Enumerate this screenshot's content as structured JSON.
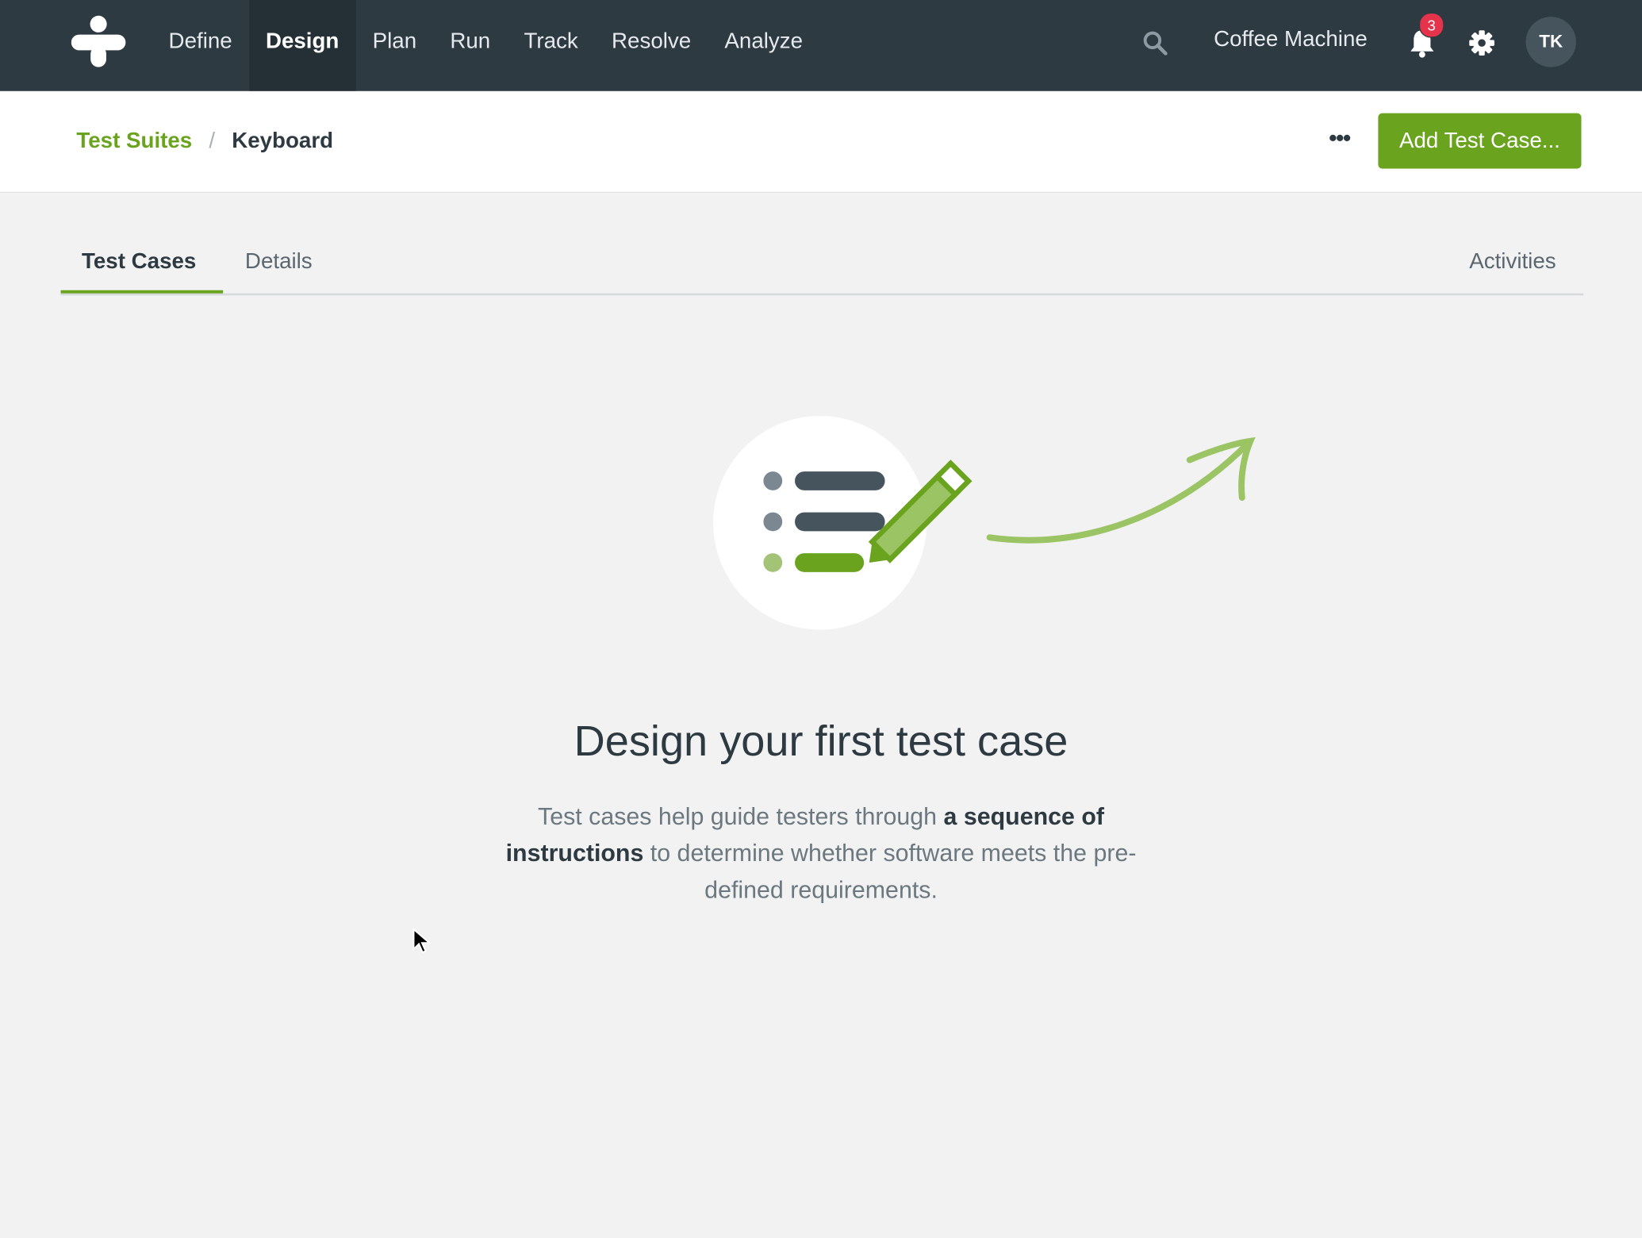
{
  "nav": {
    "items": [
      {
        "label": "Define"
      },
      {
        "label": "Design"
      },
      {
        "label": "Plan"
      },
      {
        "label": "Run"
      },
      {
        "label": "Track"
      },
      {
        "label": "Resolve"
      },
      {
        "label": "Analyze"
      }
    ],
    "active": "Design",
    "project_name": "Coffee Machine",
    "notification_count": "3",
    "avatar_initials": "TK"
  },
  "breadcrumb": {
    "parent": "Test Suites",
    "separator": "/",
    "current": "Keyboard"
  },
  "header": {
    "more_label": "•••",
    "add_button_label": "Add Test Case..."
  },
  "tabs": {
    "test_cases": "Test Cases",
    "details": "Details",
    "activities": "Activities"
  },
  "empty_state": {
    "title": "Design your first test case",
    "desc_part1": "Test cases help guide testers through ",
    "desc_bold1": "a sequence of instructions",
    "desc_part2": " to determine whether software meets the pre-defined requirements."
  },
  "colors": {
    "nav_bg": "#2e3a42",
    "accent": "#6aa31e",
    "badge": "#e5334c"
  },
  "icons": [
    "logo-icon",
    "search-icon",
    "bell-icon",
    "gear-icon",
    "pencil-icon",
    "arrow-icon",
    "cursor-icon"
  ]
}
